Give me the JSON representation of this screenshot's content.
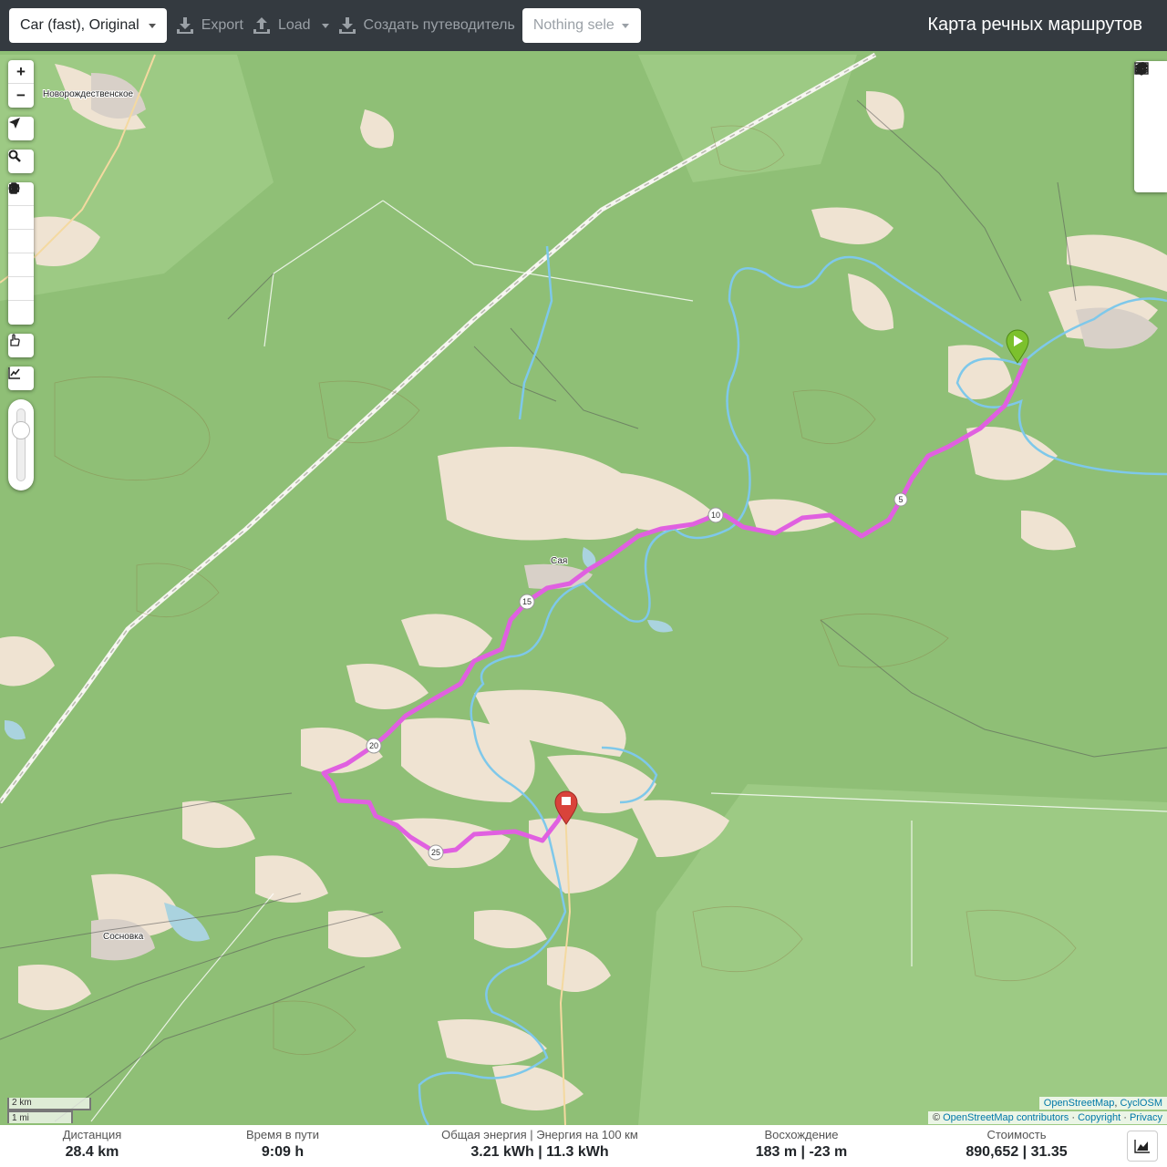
{
  "topbar": {
    "profile_label": "Car (fast), Original",
    "export_label": "Export",
    "load_label": "Load",
    "guide_label": "Создать путеводитель",
    "select_placeholder": "Nothing sele",
    "app_title": "Карта речных маршрутов"
  },
  "map": {
    "places": {
      "novorozhdestvenskoe": "Новорождественское",
      "saya": "Сая",
      "sosnovka": "Сосновка"
    },
    "km_markers": [
      "5",
      "10",
      "15",
      "20",
      "25"
    ],
    "scale": {
      "metric": "2 km",
      "imperial": "1 mi"
    },
    "attribution": {
      "line1_a": "OpenStreetMap",
      "line1_sep": ", ",
      "line1_b": "CyclOSM",
      "line2_prefix": "© ",
      "line2_a": "OpenStreetMap contributors",
      "line2_sep1": " · ",
      "line2_b": "Copyright",
      "line2_sep2": " · ",
      "line2_c": "Privacy"
    },
    "controls": {
      "zoom_in": "+",
      "zoom_out": "−"
    },
    "colors": {
      "route": "#e060e0",
      "start_marker": "#7cc12d",
      "end_marker": "#d9433b",
      "forest": "#8fbf76",
      "clearing": "#f0e6d8",
      "river": "#7ec8ea"
    }
  },
  "stats": {
    "distance": {
      "label": "Дистанция",
      "value": "28.4 km"
    },
    "time": {
      "label": "Время в пути",
      "value": "9:09 h"
    },
    "energy": {
      "label": "Общая энергия | Энергия на 100 км",
      "value": "3.21 kWh | 11.3 kWh"
    },
    "ascent": {
      "label": "Восхождение",
      "value": "183 m | -23 m"
    },
    "cost": {
      "label": "Стоимость",
      "value": "890,652 | 31.35"
    }
  }
}
